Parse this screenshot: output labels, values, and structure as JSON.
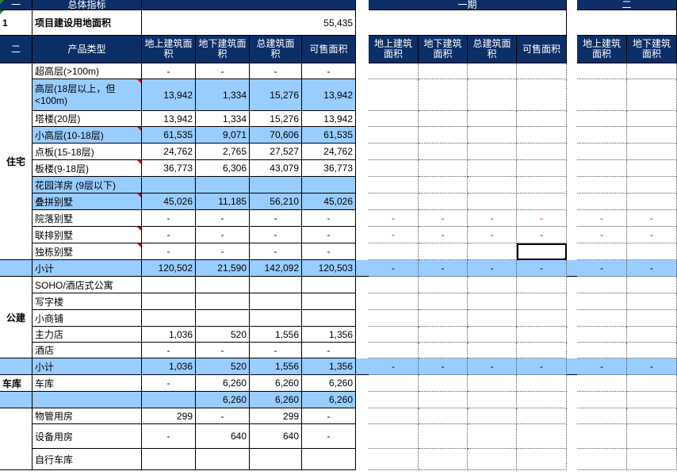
{
  "top": {
    "num": "一",
    "label": "总体指标",
    "phase1": "一期",
    "phase2": "二"
  },
  "land": {
    "num": "1",
    "label": "项目建设用地面积",
    "value": "55,435"
  },
  "header": {
    "num": "二",
    "type": "产品类型",
    "c1": "地上建筑面积",
    "c2": "地下建筑面积",
    "c3": "总建筑面积",
    "c4": "可售面积"
  },
  "groups": {
    "residential": "住宅",
    "public": "公建",
    "garage": "车库"
  },
  "rows": [
    {
      "name": "超高层(>100m)",
      "c": [
        "-",
        "-",
        "-",
        "-"
      ]
    },
    {
      "name": "高层(18层以上，但<100m)",
      "c": [
        "13,942",
        "1,334",
        "15,276",
        "13,942"
      ]
    },
    {
      "name": "塔楼(20层)",
      "c": [
        "13,942",
        "1,334",
        "15,276",
        "13,942"
      ]
    },
    {
      "name": "小高层(10-18层)",
      "c": [
        "61,535",
        "9,071",
        "70,606",
        "61,535"
      ]
    },
    {
      "name": "点板(15-18层)",
      "c": [
        "24,762",
        "2,765",
        "27,527",
        "24,762"
      ]
    },
    {
      "name": "板楼(9-18层)",
      "c": [
        "36,773",
        "6,306",
        "43,079",
        "36,773"
      ]
    },
    {
      "name": "花园洋房 (9层以下)",
      "c": [
        "",
        "",
        "",
        ""
      ]
    },
    {
      "name": "叠拼别墅",
      "c": [
        "45,026",
        "11,185",
        "56,210",
        "45,026"
      ]
    },
    {
      "name": "院落别墅",
      "c": [
        "-",
        "-",
        "-",
        "-"
      ]
    },
    {
      "name": "联排别墅",
      "c": [
        "-",
        "-",
        "-",
        "-"
      ]
    },
    {
      "name": "独栋别墅",
      "c": [
        "-",
        "-",
        "-",
        "-"
      ]
    },
    {
      "name": "小计",
      "c": [
        "120,502",
        "21,590",
        "142,092",
        "120,503"
      ]
    },
    {
      "name": "SOHO/酒店式公寓",
      "c": [
        "",
        "",
        "",
        ""
      ]
    },
    {
      "name": "写字楼",
      "c": [
        "",
        "",
        "",
        ""
      ]
    },
    {
      "name": "小商铺",
      "c": [
        "",
        "",
        "",
        ""
      ]
    },
    {
      "name": "主力店",
      "c": [
        "1,036",
        "520",
        "1,556",
        "1,356"
      ]
    },
    {
      "name": "酒店",
      "c": [
        "-",
        "-",
        "-",
        "-"
      ]
    },
    {
      "name": "小计",
      "c": [
        "1,036",
        "520",
        "1,556",
        "1,356"
      ]
    },
    {
      "name": "车库",
      "c": [
        "-",
        "6,260",
        "6,260",
        "6,260"
      ]
    },
    {
      "name": "",
      "c": [
        "",
        "6,260",
        "6,260",
        "6,260"
      ]
    },
    {
      "name": "物管用房",
      "c": [
        "299",
        "-",
        "299",
        "-"
      ]
    },
    {
      "name": "设备用房",
      "c": [
        "-",
        "640",
        "640",
        "-"
      ]
    },
    {
      "name": "自行车库",
      "c": [
        "",
        "",
        "",
        ""
      ]
    }
  ],
  "phase_dash": "-",
  "colors": {
    "header_bg": "#0d2f68",
    "highlight_bg": "#99ccff",
    "comment_marker": "#e00000"
  }
}
